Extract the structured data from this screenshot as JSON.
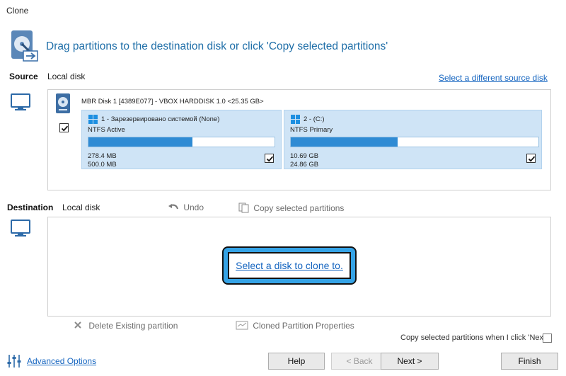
{
  "window": {
    "title": "Clone"
  },
  "header": {
    "text": "Drag partitions to the destination disk or click 'Copy selected partitions'"
  },
  "source": {
    "label": "Source",
    "disk_type": "Local disk",
    "select_link": "Select a different source disk",
    "disk_title": "MBR Disk 1 [4389E077] - VBOX HARDDISK 1.0  <25.35 GB>",
    "disk_checked": true,
    "partitions": [
      {
        "name": "1 - Зарезервировано системой (None)",
        "fs": "NTFS Active",
        "used": "278.4 MB",
        "total": "500.0 MB",
        "fill_fraction": 0.56,
        "checked": true
      },
      {
        "name": "2 -  (C:)",
        "fs": "NTFS Primary",
        "used": "10.69 GB",
        "total": "24.86 GB",
        "fill_fraction": 0.43,
        "checked": true
      }
    ]
  },
  "destination": {
    "label": "Destination",
    "disk_type": "Local disk",
    "undo": "Undo",
    "copy_selected": "Copy selected partitions",
    "select_link": "Select a disk to clone to.",
    "delete_existing": "Delete Existing partition",
    "cloned_props": "Cloned Partition Properties",
    "copy_on_next": "Copy selected partitions when I click 'Next'"
  },
  "footer": {
    "advanced": "Advanced Options",
    "help": "Help",
    "back": "< Back",
    "next": "Next >",
    "finish": "Finish"
  },
  "colors": {
    "accent": "#2f8bd4",
    "link": "#1565c0",
    "partition_bg": "#cfe4f6",
    "highlight": "#35a3e6"
  }
}
